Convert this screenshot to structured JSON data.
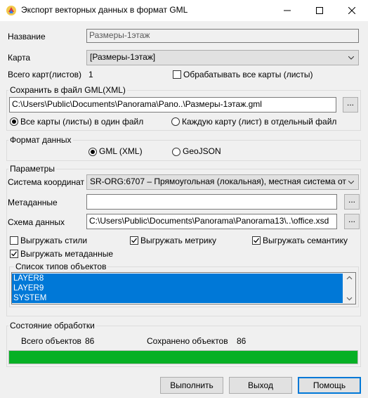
{
  "window": {
    "title": "Экспорт векторных данных в формат GML"
  },
  "name_label": "Название",
  "name_value": "Размеры-1этаж",
  "map_label": "Карта",
  "map_value": "[Размеры-1этаж]",
  "total_maps_label": "Всего карт(листов)",
  "total_maps_value": "1",
  "process_all_label": "Обрабатывать все карты (листы)",
  "process_all_checked": false,
  "save_group": {
    "title": "Сохранить в файл GML(XML)",
    "path": "C:\\Users\\Public\\Documents\\Panorama\\Pano..\\Размеры-1этаж.gml",
    "browse_label": "...",
    "radio_all": "Все карты (листы) в один файл",
    "radio_each": "Каждую карту (лист) в  отдельный файл",
    "selected": "all"
  },
  "format_group": {
    "title": "Формат данных",
    "gml": "GML (XML)",
    "geojson": "GeoJSON",
    "selected": "gml"
  },
  "params_group": {
    "title": "Параметры",
    "coord_label": "Система координат",
    "coord_value": "SR-ORG:6707 – Прямоугольная (локальная), местная система от",
    "meta_label": "Метаданные",
    "meta_value": "",
    "schema_label": "Схема данных",
    "schema_value": "C:\\Users\\Public\\Documents\\Panorama\\Panorama13\\..\\office.xsd",
    "browse_label": "...",
    "export_styles": "Выгружать стили",
    "export_styles_checked": false,
    "export_metric": "Выгружать метрику",
    "export_metric_checked": true,
    "export_semantic": "Выгружать семантику",
    "export_semantic_checked": true,
    "export_metadata": "Выгружать метаданные",
    "export_metadata_checked": true,
    "types_title": "Список типов объектов",
    "types": [
      "LAYER8",
      "LAYER9",
      "SYSTEM"
    ]
  },
  "status_group": {
    "title": "Состояние обработки",
    "total_label": "Всего объектов",
    "total_value": "86",
    "saved_label": "Сохранено объектов",
    "saved_value": "86",
    "progress": 1.0
  },
  "buttons": {
    "run": "Выполнить",
    "exit": "Выход",
    "help": "Помощь"
  },
  "colors": {
    "accent": "#0078d7",
    "progress": "#06b025"
  }
}
